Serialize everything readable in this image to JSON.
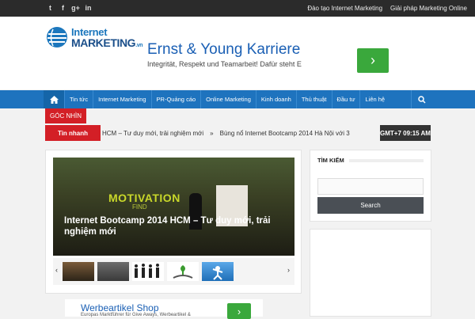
{
  "topbar": {
    "social": [
      {
        "icon": "twitter-icon",
        "glyph": "t"
      },
      {
        "icon": "facebook-icon",
        "glyph": "f"
      },
      {
        "icon": "google-plus-icon",
        "glyph": "g+"
      },
      {
        "icon": "linkedin-icon",
        "glyph": "in"
      }
    ],
    "links": [
      "Đào tạo Internet Marketing",
      "Giải pháp Marketing Online"
    ]
  },
  "logo": {
    "line1": "Internet",
    "line2": "MARKETING",
    "suffix": ".vn"
  },
  "ad_top": {
    "headline": "Ernst & Young Karriere",
    "subline": "Integrität, Respekt und Teamarbeit! Dafür steht E",
    "button": "›"
  },
  "nav": {
    "items": [
      "Tin tức",
      "Internet Marketing",
      "PR-Quảng cáo",
      "Online Marketing",
      "Kinh doanh",
      "Thủ thuật",
      "Đầu tư",
      "Liên hệ"
    ],
    "home_icon": "home-icon",
    "search_icon": "search-icon"
  },
  "section_label": "GÓC NHÌN",
  "ticker": {
    "label": "Tin nhanh",
    "items": [
      "HCM – Tư duy mới, trải nghiệm mới",
      "Bùng nổ Internet Bootcamp 2014 Hà Nội với 3"
    ],
    "bullet": "»"
  },
  "clock": "GMT+7 09:15 AM",
  "slider": {
    "slide_text_1": "MOTIVATION",
    "slide_text_2": "FIND",
    "caption": "Internet Bootcamp 2014 HCM – Tư duy mới, trải nghiệm mới",
    "prev": "‹",
    "next": "›"
  },
  "sidebar": {
    "search_title": "TÌM KIẾM",
    "search_placeholder": "",
    "search_button": "Search"
  },
  "ad_bottom": {
    "headline": "Werbeartikel Shop",
    "subline": "Europas Marktführer für Give Aways, Werbeartikel &",
    "button": "›"
  },
  "colors": {
    "nav_blue": "#1e73be",
    "accent_red": "#d31f26",
    "ad_green": "#3aa83c"
  }
}
